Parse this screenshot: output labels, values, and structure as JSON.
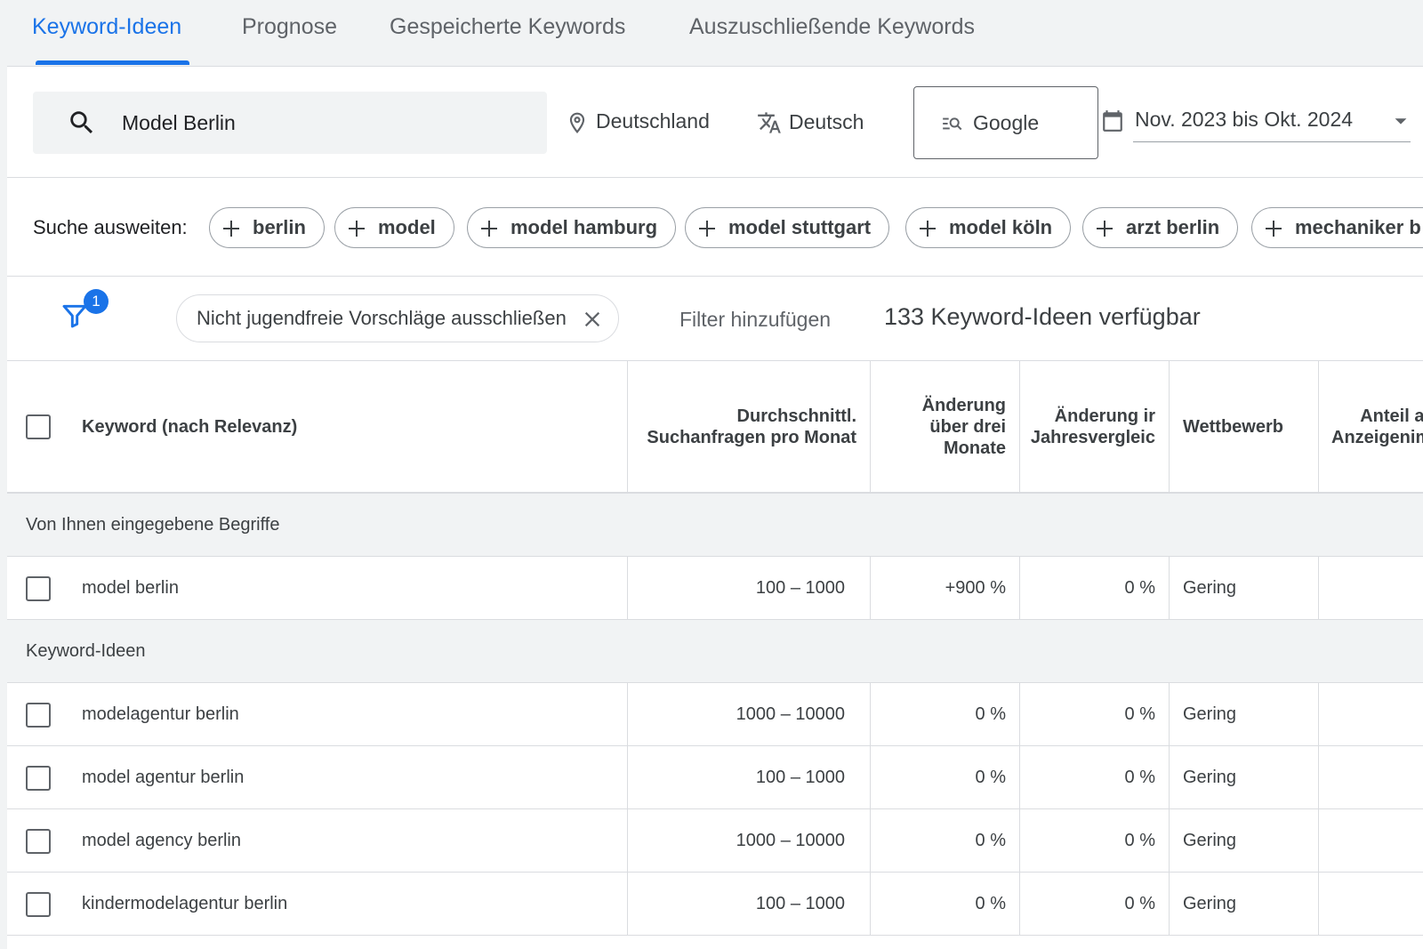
{
  "tabs": [
    {
      "label": "Keyword-Ideen",
      "active": true
    },
    {
      "label": "Prognose",
      "active": false
    },
    {
      "label": "Gespeicherte Keywords",
      "active": false
    },
    {
      "label": "Auszuschließende Keywords",
      "active": false
    }
  ],
  "search": {
    "value": "Model Berlin",
    "location": "Deutschland",
    "language": "Deutsch",
    "network": "Google",
    "date_range": "Nov. 2023 bis Okt. 2024"
  },
  "expand": {
    "label": "Suche ausweiten:",
    "chips": [
      "berlin",
      "model",
      "model hamburg",
      "model stuttgart",
      "model köln",
      "arzt berlin",
      "mechaniker b"
    ]
  },
  "filters": {
    "badge_count": "1",
    "active_filter": "Nicht jugendfreie Vorschläge ausschließen",
    "add_filter_label": "Filter hinzufügen",
    "count_text": "133 Keyword-Ideen verfügbar"
  },
  "table": {
    "headers": {
      "keyword": "Keyword (nach Relevanz)",
      "avg_searches_1": "Durchschnittl.",
      "avg_searches_2": "Suchanfragen pro Monat",
      "change3m_1": "Änderung",
      "change3m_2": "über drei",
      "change3m_3": "Monate",
      "yoy_1": "Änderung ir",
      "yoy_2": "Jahresvergleic",
      "competition": "Wettbewerb",
      "share_1": "Anteil ar",
      "share_2": "Anzeigenim"
    },
    "group_entered": "Von Ihnen eingegebene Begriffe",
    "entered_rows": [
      {
        "keyword": "model berlin",
        "searches": "100 – 1000",
        "change3m": "+900 %",
        "yoy": "0 %",
        "competition": "Gering"
      }
    ],
    "group_ideas": "Keyword-Ideen",
    "idea_rows": [
      {
        "keyword": "modelagentur berlin",
        "searches": "1000 – 10000",
        "change3m": "0 %",
        "yoy": "0 %",
        "competition": "Gering"
      },
      {
        "keyword": "model agentur berlin",
        "searches": "100 – 1000",
        "change3m": "0 %",
        "yoy": "0 %",
        "competition": "Gering"
      },
      {
        "keyword": "model agency berlin",
        "searches": "1000 – 10000",
        "change3m": "0 %",
        "yoy": "0 %",
        "competition": "Gering"
      },
      {
        "keyword": "kindermodelagentur berlin",
        "searches": "100 – 1000",
        "change3m": "0 %",
        "yoy": "0 %",
        "competition": "Gering"
      }
    ]
  }
}
